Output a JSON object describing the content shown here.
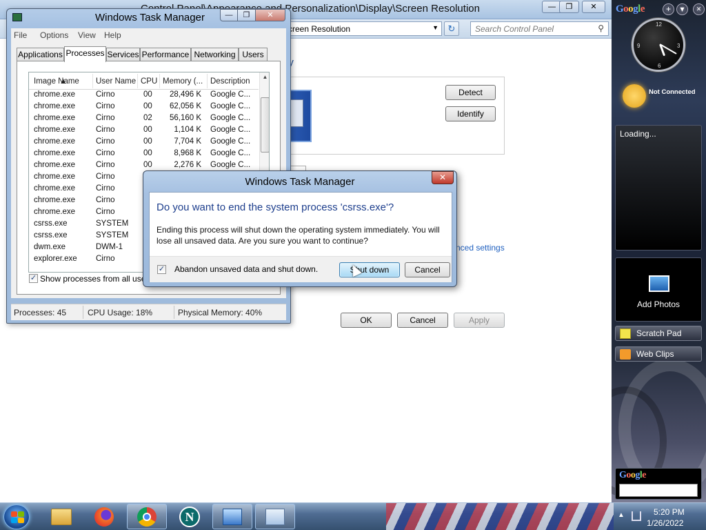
{
  "control_panel": {
    "title": "Control Panel\\Appearance and Personalization\\Display\\Screen Resolution",
    "address": "Screen Resolution",
    "search_placeholder": "Search Control Panel",
    "heading_fragment": "ay",
    "detect_label": "Detect",
    "identify_label": "Identify",
    "advanced_link_fragment": "nced settings",
    "ok_label": "OK",
    "cancel_label": "Cancel",
    "apply_label": "Apply"
  },
  "task_manager": {
    "title": "Windows Task Manager",
    "menu": [
      "File",
      "Options",
      "View",
      "Help"
    ],
    "tabs": [
      "Applications",
      "Processes",
      "Services",
      "Performance",
      "Networking",
      "Users"
    ],
    "active_tab": "Processes",
    "columns": [
      "Image Name",
      "User Name",
      "CPU",
      "Memory (...",
      "Description"
    ],
    "rows": [
      {
        "name": "chrome.exe",
        "user": "Cirno",
        "cpu": "00",
        "mem": "28,496 K",
        "desc": "Google C..."
      },
      {
        "name": "chrome.exe",
        "user": "Cirno",
        "cpu": "00",
        "mem": "62,056 K",
        "desc": "Google C..."
      },
      {
        "name": "chrome.exe",
        "user": "Cirno",
        "cpu": "02",
        "mem": "56,160 K",
        "desc": "Google C..."
      },
      {
        "name": "chrome.exe",
        "user": "Cirno",
        "cpu": "00",
        "mem": "1,104 K",
        "desc": "Google C..."
      },
      {
        "name": "chrome.exe",
        "user": "Cirno",
        "cpu": "00",
        "mem": "7,704 K",
        "desc": "Google C..."
      },
      {
        "name": "chrome.exe",
        "user": "Cirno",
        "cpu": "00",
        "mem": "8,968 K",
        "desc": "Google C..."
      },
      {
        "name": "chrome.exe",
        "user": "Cirno",
        "cpu": "00",
        "mem": "2,276 K",
        "desc": "Google C..."
      },
      {
        "name": "chrome.exe",
        "user": "Cirno",
        "cpu": "",
        "mem": "",
        "desc": ""
      },
      {
        "name": "chrome.exe",
        "user": "Cirno",
        "cpu": "",
        "mem": "",
        "desc": ""
      },
      {
        "name": "chrome.exe",
        "user": "Cirno",
        "cpu": "",
        "mem": "",
        "desc": ""
      },
      {
        "name": "chrome.exe",
        "user": "Cirno",
        "cpu": "",
        "mem": "",
        "desc": ""
      },
      {
        "name": "csrss.exe",
        "user": "SYSTEM",
        "cpu": "",
        "mem": "",
        "desc": ""
      },
      {
        "name": "csrss.exe",
        "user": "SYSTEM",
        "cpu": "",
        "mem": "",
        "desc": ""
      },
      {
        "name": "dwm.exe",
        "user": "DWM-1",
        "cpu": "",
        "mem": "",
        "desc": ""
      },
      {
        "name": "explorer.exe",
        "user": "Cirno",
        "cpu": "",
        "mem": "",
        "desc": ""
      }
    ],
    "show_all_label": "Show processes from all users",
    "show_all_checked": true,
    "status": {
      "processes": "Processes: 45",
      "cpu": "CPU Usage: 18%",
      "memory": "Physical Memory: 40%"
    }
  },
  "dialog": {
    "title": "Windows Task Manager",
    "main_instruction": "Do you want to end the system process 'csrss.exe'?",
    "content": "Ending this process will shut down the operating system immediately.  You will lose all unsaved data.  Are you sure you want to continue?",
    "checkbox_label": "Abandon unsaved data and shut down.",
    "checkbox_checked": true,
    "shutdown_label": "Shut down",
    "cancel_label": "Cancel"
  },
  "sidebar": {
    "logo_letters": [
      "G",
      "o",
      "o",
      "g",
      "l",
      "e"
    ],
    "add_symbol": "+",
    "options_symbol": "▾",
    "weather_status": "Not Connected",
    "loading_text": "Loading...",
    "photos_label": "Add Photos",
    "scratch_pad": "Scratch Pad",
    "web_clips": "Web Clips"
  },
  "clock_numbers": [
    "12",
    "3",
    "6",
    "9"
  ],
  "taskbar": {
    "items": [
      "windows-explorer",
      "firefox",
      "chrome",
      "netscape",
      "control-panel",
      "task-manager"
    ],
    "time": "5:20 PM",
    "date": "1/26/2022"
  },
  "colors": {
    "dialog_heading": "#1c3d8c",
    "link": "#1e5fbf",
    "title_bar": "#a8c3e2"
  }
}
